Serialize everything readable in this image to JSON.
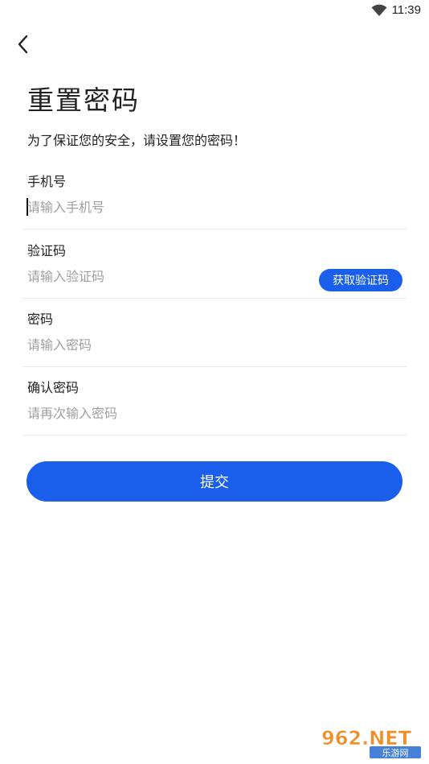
{
  "status_bar": {
    "time": "11:39"
  },
  "header": {
    "title": "重置密码",
    "subtitle": "为了保证您的安全，请设置您的密码！"
  },
  "form": {
    "phone": {
      "label": "手机号",
      "placeholder": "请输入手机号",
      "value": ""
    },
    "code": {
      "label": "验证码",
      "placeholder": "请输入验证码",
      "value": "",
      "button_label": "获取验证码"
    },
    "password": {
      "label": "密码",
      "placeholder": "请输入密码",
      "value": ""
    },
    "confirm": {
      "label": "确认密码",
      "placeholder": "请再次输入密码",
      "value": ""
    }
  },
  "submit_label": "提交",
  "watermark": {
    "text_top": "962.NET",
    "text_bottom": "乐游网"
  },
  "colors": {
    "accent": "#1a5fec",
    "placeholder": "#a0a0a0",
    "divider": "#eaeaea"
  }
}
